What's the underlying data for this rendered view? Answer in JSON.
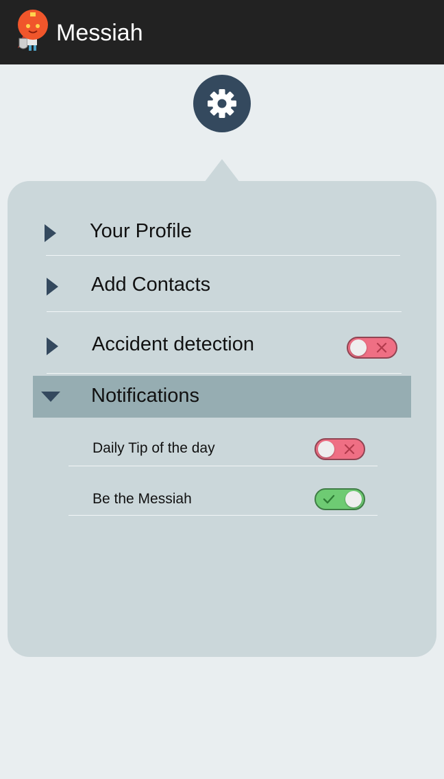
{
  "app": {
    "title": "Messiah"
  },
  "menu": {
    "items": [
      {
        "label": "Your Profile"
      },
      {
        "label": "Add Contacts"
      },
      {
        "label": "Accident detection",
        "toggle": "off"
      },
      {
        "label": "Notifications",
        "expanded": true
      }
    ]
  },
  "notifications": {
    "items": [
      {
        "label": "Daily Tip of the day",
        "toggle": "off"
      },
      {
        "label": "Be the Messiah",
        "toggle": "on"
      }
    ]
  },
  "colors": {
    "action_bar": "#222222",
    "accent": "#34495e",
    "panel": "#cbd7da",
    "selected_row": "#96adb2",
    "toggle_off": "#ef6f84",
    "toggle_on": "#6ecb73"
  },
  "icons": {
    "app_logo": "orange-superhero-mascot-icon",
    "settings": "gear-icon",
    "collapsed": "triangle-right-icon",
    "expanded": "triangle-down-icon",
    "toggle_off": "x-icon",
    "toggle_on": "check-icon"
  }
}
